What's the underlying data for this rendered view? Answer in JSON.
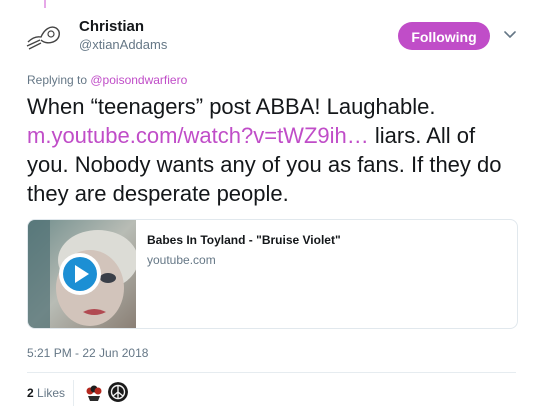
{
  "author": {
    "display_name": "Christian",
    "handle": "@xtianAddams",
    "avatar_icon": "sketch-avatar-icon"
  },
  "follow_button": {
    "label": "Following",
    "color": "#c04dc8"
  },
  "more_menu_icon": "chevron-down-icon",
  "reply": {
    "prefix": "Replying to ",
    "mention": "@poisondwarfiero"
  },
  "tweet": {
    "text_before_link": "When “teenagers” post ABBA! Laughable. ",
    "link": "m.youtube.com/watch?v=tWZ9ih…",
    "text_after_link": " liars. All of you. Nobody wants any of you as fans. If they do they are desperate people.",
    "link_color": "#c04dc8"
  },
  "card": {
    "title": "Babes In Toyland - \"Bruise Violet\"",
    "domain": "youtube.com",
    "play_icon": "play-icon"
  },
  "meta": {
    "timestamp": "5:21 PM - 22 Jun 2018"
  },
  "stats": {
    "likes_count": "2",
    "likes_label": " Likes",
    "liker_avatars": [
      "liker-avatar-red-icon",
      "liker-avatar-dark-icon"
    ]
  }
}
